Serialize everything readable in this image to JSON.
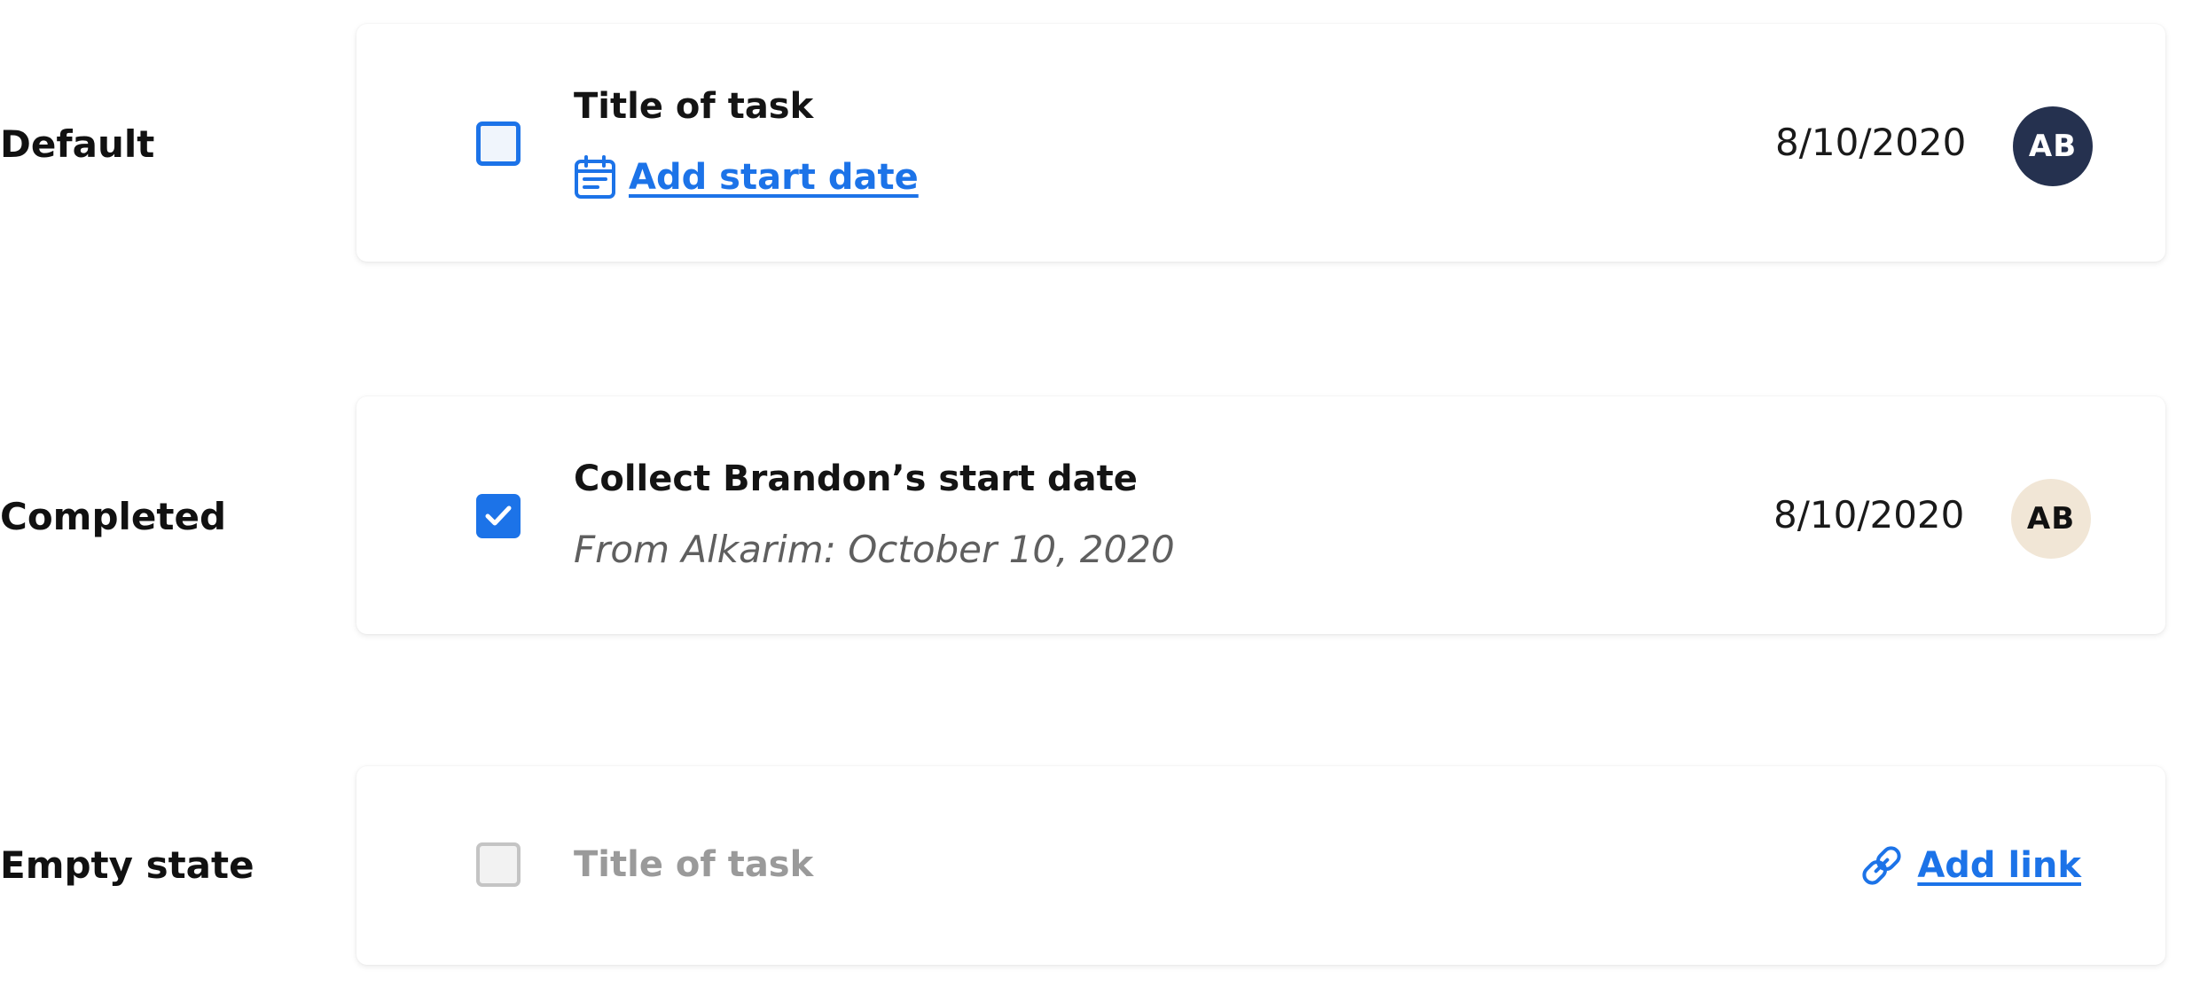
{
  "states": {
    "default": {
      "label": "Default",
      "task_title": "Title of task",
      "add_start_date_label": "Add start date",
      "due_date": "8/10/2020",
      "avatar_initials": "AB",
      "checked": false
    },
    "completed": {
      "label": "Completed",
      "task_title": "Collect Brandon’s start date",
      "subtext": "From Alkarim: October 10, 2020",
      "due_date": "8/10/2020",
      "avatar_initials": "AB",
      "checked": true
    },
    "empty": {
      "label": "Empty state",
      "task_title": "Title of task",
      "add_link_label": "Add link",
      "checked": false
    }
  },
  "icons": {
    "calendar": "calendar-icon",
    "checkmark": "checkmark-icon",
    "link": "link-icon"
  },
  "colors": {
    "accent": "#1c73e8",
    "avatar_dark": "#25314f",
    "avatar_light": "#f1e6d6",
    "muted_text": "#9a9a9a"
  }
}
